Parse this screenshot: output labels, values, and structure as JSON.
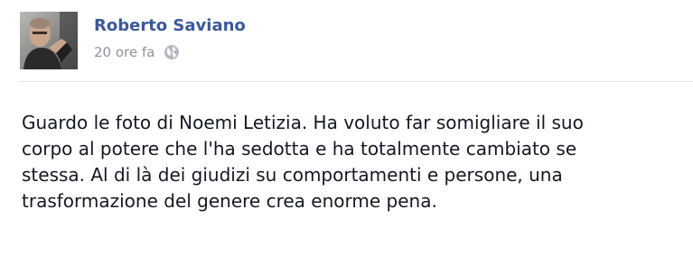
{
  "post": {
    "author": "Roberto Saviano",
    "timestamp": "20 ore fa",
    "privacy_icon": "globe-icon",
    "text_lines": [
      "Guardo le foto di Noemi Letizia. Ha voluto far somigliare il suo",
      "corpo al potere che l'ha sedotta e ha totalmente cambiato se",
      "stessa. Al di là dei giudizi su comportamenti e persone, una",
      "trasformazione del genere crea enorme pena."
    ]
  },
  "colors": {
    "author_link": "#3b5998",
    "meta_gray": "#90949c",
    "body_text": "#141823",
    "divider": "#e2e4e9"
  }
}
